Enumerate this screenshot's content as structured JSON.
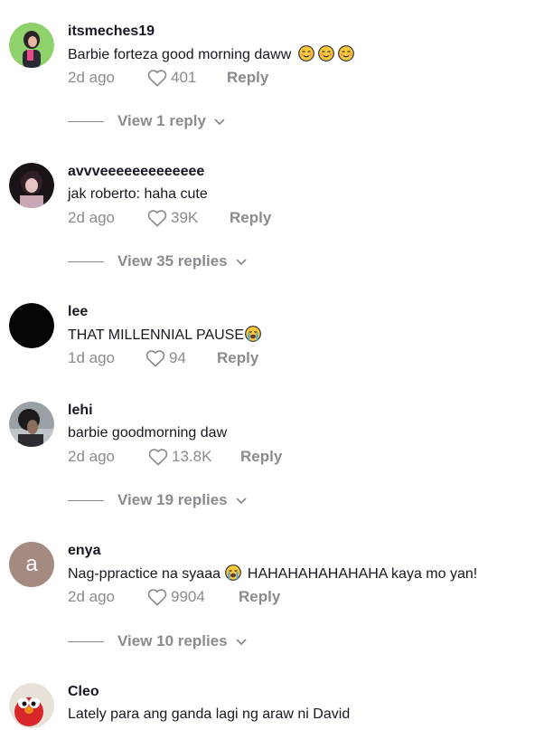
{
  "comments": [
    {
      "username": "itsmeches19",
      "text": "Barbie forteza good morning daww",
      "emoji": [
        "relieved",
        "relieved",
        "relieved"
      ],
      "time": "2d ago",
      "likes": "401",
      "reply_label": "Reply",
      "view_replies": "View 1 reply",
      "avatar": "photo"
    },
    {
      "username": "avvveeeeeeeeeeeee",
      "text": "jak roberto: haha cute",
      "emoji": [],
      "time": "2d ago",
      "likes": "39K",
      "reply_label": "Reply",
      "view_replies": "View 35 replies",
      "avatar": "photo"
    },
    {
      "username": "lee",
      "text": "THAT MILLENNIAL PAUSE",
      "emoji": [
        "crying"
      ],
      "time": "1d ago",
      "likes": "94",
      "reply_label": "Reply",
      "view_replies": "",
      "avatar": "black"
    },
    {
      "username": "lehi",
      "text": "barbie goodmorning daw",
      "emoji": [],
      "time": "2d ago",
      "likes": "13.8K",
      "reply_label": "Reply",
      "view_replies": "View 19 replies",
      "avatar": "photo"
    },
    {
      "username": "enya",
      "text": "Nag-ppractice na syaaa",
      "text2": "HAHAHAHAHAHAHA kaya mo yan!",
      "emoji": [
        "crying"
      ],
      "time": "2d ago",
      "likes": "9904",
      "reply_label": "Reply",
      "view_replies": "View 10 replies",
      "avatar": "letter",
      "avatar_letter": "a"
    },
    {
      "username": "Cleo",
      "text": "Lately para ang ganda lagi ng araw ni David",
      "emoji": [],
      "time": "",
      "likes": "",
      "reply_label": "",
      "view_replies": "",
      "avatar": "elmo"
    }
  ]
}
